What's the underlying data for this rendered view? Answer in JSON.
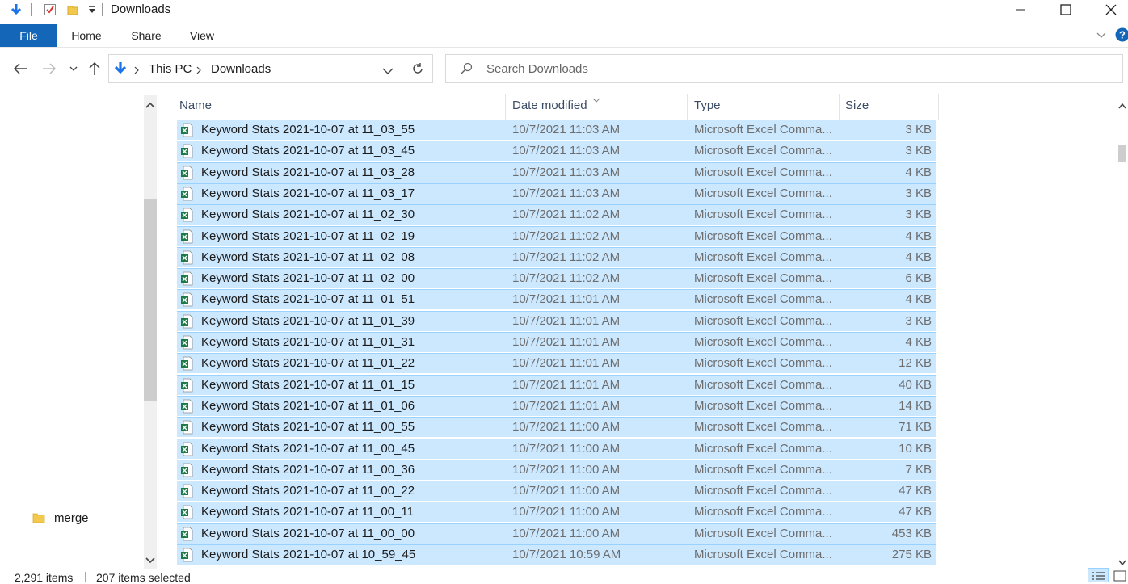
{
  "window": {
    "title": "Downloads",
    "minimize_label": "Minimize",
    "maximize_label": "Maximize",
    "close_label": "Close"
  },
  "ribbon": {
    "tabs": [
      "File",
      "Home",
      "Share",
      "View"
    ]
  },
  "address": {
    "breadcrumb": [
      "This PC",
      "Downloads"
    ]
  },
  "search": {
    "placeholder": "Search Downloads"
  },
  "navpane": {
    "items": [
      {
        "label": "merge",
        "icon": "folder-icon"
      }
    ]
  },
  "columns": {
    "name": "Name",
    "date": "Date modified",
    "type": "Type",
    "size": "Size"
  },
  "files": [
    {
      "name": "Keyword Stats 2021-10-07 at 11_03_55",
      "date": "10/7/2021 11:03 AM",
      "type": "Microsoft Excel Comma...",
      "size": "3 KB"
    },
    {
      "name": "Keyword Stats 2021-10-07 at 11_03_45",
      "date": "10/7/2021 11:03 AM",
      "type": "Microsoft Excel Comma...",
      "size": "3 KB"
    },
    {
      "name": "Keyword Stats 2021-10-07 at 11_03_28",
      "date": "10/7/2021 11:03 AM",
      "type": "Microsoft Excel Comma...",
      "size": "4 KB"
    },
    {
      "name": "Keyword Stats 2021-10-07 at 11_03_17",
      "date": "10/7/2021 11:03 AM",
      "type": "Microsoft Excel Comma...",
      "size": "3 KB"
    },
    {
      "name": "Keyword Stats 2021-10-07 at 11_02_30",
      "date": "10/7/2021 11:02 AM",
      "type": "Microsoft Excel Comma...",
      "size": "3 KB"
    },
    {
      "name": "Keyword Stats 2021-10-07 at 11_02_19",
      "date": "10/7/2021 11:02 AM",
      "type": "Microsoft Excel Comma...",
      "size": "4 KB"
    },
    {
      "name": "Keyword Stats 2021-10-07 at 11_02_08",
      "date": "10/7/2021 11:02 AM",
      "type": "Microsoft Excel Comma...",
      "size": "4 KB"
    },
    {
      "name": "Keyword Stats 2021-10-07 at 11_02_00",
      "date": "10/7/2021 11:02 AM",
      "type": "Microsoft Excel Comma...",
      "size": "6 KB"
    },
    {
      "name": "Keyword Stats 2021-10-07 at 11_01_51",
      "date": "10/7/2021 11:01 AM",
      "type": "Microsoft Excel Comma...",
      "size": "4 KB"
    },
    {
      "name": "Keyword Stats 2021-10-07 at 11_01_39",
      "date": "10/7/2021 11:01 AM",
      "type": "Microsoft Excel Comma...",
      "size": "3 KB"
    },
    {
      "name": "Keyword Stats 2021-10-07 at 11_01_31",
      "date": "10/7/2021 11:01 AM",
      "type": "Microsoft Excel Comma...",
      "size": "4 KB"
    },
    {
      "name": "Keyword Stats 2021-10-07 at 11_01_22",
      "date": "10/7/2021 11:01 AM",
      "type": "Microsoft Excel Comma...",
      "size": "12 KB"
    },
    {
      "name": "Keyword Stats 2021-10-07 at 11_01_15",
      "date": "10/7/2021 11:01 AM",
      "type": "Microsoft Excel Comma...",
      "size": "40 KB"
    },
    {
      "name": "Keyword Stats 2021-10-07 at 11_01_06",
      "date": "10/7/2021 11:01 AM",
      "type": "Microsoft Excel Comma...",
      "size": "14 KB"
    },
    {
      "name": "Keyword Stats 2021-10-07 at 11_00_55",
      "date": "10/7/2021 11:00 AM",
      "type": "Microsoft Excel Comma...",
      "size": "71 KB"
    },
    {
      "name": "Keyword Stats 2021-10-07 at 11_00_45",
      "date": "10/7/2021 11:00 AM",
      "type": "Microsoft Excel Comma...",
      "size": "10 KB"
    },
    {
      "name": "Keyword Stats 2021-10-07 at 11_00_36",
      "date": "10/7/2021 11:00 AM",
      "type": "Microsoft Excel Comma...",
      "size": "7 KB"
    },
    {
      "name": "Keyword Stats 2021-10-07 at 11_00_22",
      "date": "10/7/2021 11:00 AM",
      "type": "Microsoft Excel Comma...",
      "size": "47 KB"
    },
    {
      "name": "Keyword Stats 2021-10-07 at 11_00_11",
      "date": "10/7/2021 11:00 AM",
      "type": "Microsoft Excel Comma...",
      "size": "47 KB"
    },
    {
      "name": "Keyword Stats 2021-10-07 at 11_00_00",
      "date": "10/7/2021 11:00 AM",
      "type": "Microsoft Excel Comma...",
      "size": "453 KB"
    },
    {
      "name": "Keyword Stats 2021-10-07 at 10_59_45",
      "date": "10/7/2021 10:59 AM",
      "type": "Microsoft Excel Comma...",
      "size": "275 KB"
    }
  ],
  "status": {
    "item_count": "2,291 items",
    "selected": "207 items selected"
  },
  "colors": {
    "accent": "#1366b8",
    "selection": "#cce8ff",
    "selection_border": "#99d1ff"
  }
}
